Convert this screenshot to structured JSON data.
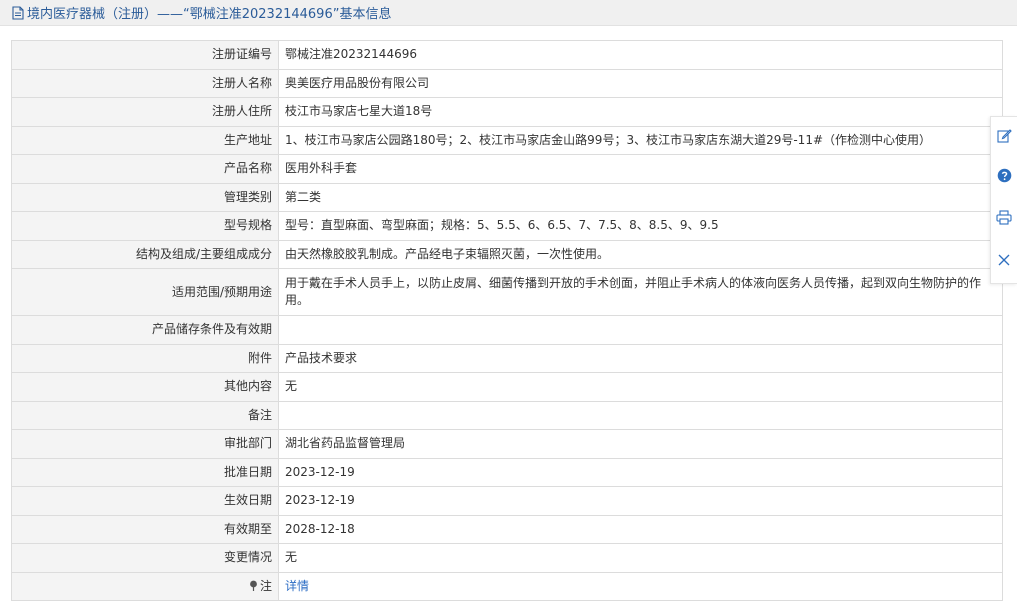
{
  "header": {
    "title": "境内医疗器械（注册）——“鄂械注准20232144696”基本信息"
  },
  "rows": [
    {
      "label": "注册证编号",
      "value": "鄂械注准20232144696"
    },
    {
      "label": "注册人名称",
      "value": "奥美医疗用品股份有限公司"
    },
    {
      "label": "注册人住所",
      "value": "枝江市马家店七星大道18号"
    },
    {
      "label": "生产地址",
      "value": "1、枝江市马家店公园路180号；2、枝江市马家店金山路99号；3、枝江市马家店东湖大道29号-11#（作检测中心使用）"
    },
    {
      "label": "产品名称",
      "value": "医用外科手套"
    },
    {
      "label": "管理类别",
      "value": "第二类"
    },
    {
      "label": "型号规格",
      "value": "型号：直型麻面、弯型麻面；规格：5、5.5、6、6.5、7、7.5、8、8.5、9、9.5"
    },
    {
      "label": "结构及组成/主要组成成分",
      "value": "由天然橡胶胶乳制成。产品经电子束辐照灭菌，一次性使用。"
    },
    {
      "label": "适用范围/预期用途",
      "value": "用于戴在手术人员手上，以防止皮屑、细菌传播到开放的手术创面，并阻止手术病人的体液向医务人员传播，起到双向生物防护的作用。"
    },
    {
      "label": "产品储存条件及有效期",
      "value": ""
    },
    {
      "label": "附件",
      "value": "产品技术要求"
    },
    {
      "label": "其他内容",
      "value": "无"
    },
    {
      "label": "备注",
      "value": ""
    },
    {
      "label": "审批部门",
      "value": "湖北省药品监督管理局"
    },
    {
      "label": "批准日期",
      "value": "2023-12-19"
    },
    {
      "label": "生效日期",
      "value": "2023-12-19"
    },
    {
      "label": "有效期至",
      "value": "2028-12-18"
    },
    {
      "label": "变更情况",
      "value": "无"
    },
    {
      "label": "注",
      "value": "详情"
    }
  ],
  "sidebar": {
    "icons": [
      "edit-icon",
      "help-icon",
      "print-icon",
      "close-icon"
    ]
  },
  "colors": {
    "header_text": "#2b5c99",
    "link": "#2b6cc4",
    "icon_blue": "#2e6fbf"
  }
}
